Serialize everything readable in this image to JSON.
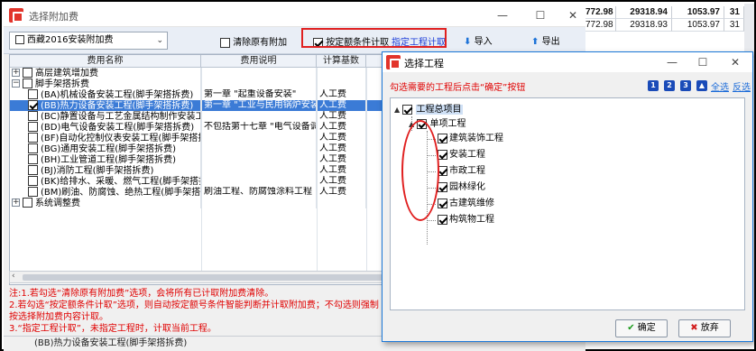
{
  "main_window": {
    "title": "选择附加费",
    "min": "—",
    "max": "☐",
    "close": "✕"
  },
  "toolbar": {
    "combo_value": "西藏2016安装附加费",
    "clear_label": "清除原有附加",
    "by_condition_label": "按定额条件计取",
    "specify_link": "指定工程计取",
    "import_label": "导入",
    "export_label": "导出"
  },
  "grid": {
    "columns": [
      "费用名称",
      "费用说明",
      "计算基数"
    ],
    "rows": [
      {
        "name": "高层建筑增加费",
        "desc": "",
        "base": "",
        "level": 0,
        "exp": "+",
        "chk": true
      },
      {
        "name": "脚手架搭拆费",
        "desc": "",
        "base": "",
        "level": 0,
        "exp": "−",
        "chk": true
      },
      {
        "name": "(BA)机械设备安装工程(脚手架搭拆费)",
        "desc": "第一章 \"起重设备安装\"",
        "base": "人工费",
        "level": 1,
        "chk": true,
        "checked": false
      },
      {
        "name": "(BB)热力设备安装工程(脚手架搭拆费)",
        "desc": "第一章 \"工业与民用锅炉安装",
        "base": "人工费",
        "level": 1,
        "chk": true,
        "checked": true,
        "selected": true
      },
      {
        "name": "(BC)静置设备与工艺金属结构制作安装工程",
        "desc": "",
        "base": "人工费",
        "level": 1,
        "chk": true,
        "checked": false
      },
      {
        "name": "(BD)电气设备安装工程(脚手架搭拆费)",
        "desc": "不包括第十七章 \"电气设备调",
        "base": "人工费",
        "level": 1,
        "chk": true,
        "checked": false
      },
      {
        "name": "(BF)自动化控制仪表安装工程(脚手架搭拆",
        "desc": "",
        "base": "人工费",
        "level": 1,
        "chk": true,
        "checked": false
      },
      {
        "name": "(BG)通用安装工程(脚手架搭拆费)",
        "desc": "",
        "base": "人工费",
        "level": 1,
        "chk": true,
        "checked": false
      },
      {
        "name": "(BH)工业管道工程(脚手架搭拆费)",
        "desc": "",
        "base": "人工费",
        "level": 1,
        "chk": true,
        "checked": false
      },
      {
        "name": "(BJ)消防工程(脚手架搭拆费)",
        "desc": "",
        "base": "人工费",
        "level": 1,
        "chk": true,
        "checked": false
      },
      {
        "name": "(BK)给排水、采暖、燃气工程(脚手架搭拆",
        "desc": "",
        "base": "人工费",
        "level": 1,
        "chk": true,
        "checked": false
      },
      {
        "name": "(BM)刷油、防腐蚀、绝热工程(脚手架搭拆",
        "desc": "刷油工程、防腐蚀涂料工程",
        "base": "人工费",
        "level": 1,
        "chk": true,
        "checked": false
      },
      {
        "name": "系统调整费",
        "desc": "",
        "base": "",
        "level": 0,
        "exp": "+",
        "chk": true
      }
    ]
  },
  "notes": [
    "注:1.若勾选“清除原有附加费”选项，会将所有已计取附加费清除。",
    "    2.若勾选“按定额条件计取”选项，则自动按定额号条件智能判断并计取附加费；不勾选则强制",
    "按选择附加费内容计取。",
    "    3.“指定工程计取”，未指定工程时，计取当前工程。"
  ],
  "status_text": "(BB)热力设备安装工程(脚手架搭拆费)",
  "sheet": {
    "rows": [
      [
        "772.98",
        "29318.94",
        "1053.97",
        "31"
      ],
      [
        "772.98",
        "29318.93",
        "1053.97",
        "31"
      ]
    ]
  },
  "dialog": {
    "title": "选择工程",
    "min": "—",
    "max": "☐",
    "close": "✕",
    "hint": "勾选需要的工程后点击“确定”按钮",
    "nums": [
      "1",
      "2",
      "3"
    ],
    "select_all": "全选",
    "invert": "反选",
    "tree": {
      "root": "工程总项目",
      "unit": "单项工程",
      "items": [
        "建筑装饰工程",
        "安装工程",
        "市政工程",
        "园林绿化",
        "古建筑维修",
        "构筑物工程"
      ]
    },
    "ok_label": "确定",
    "cancel_label": "放弃"
  },
  "colors": {
    "accent_red": "#e02020",
    "selection_blue": "#3b7bd6",
    "link_blue": "#1a3bd8",
    "dialog_border": "#1b78d8"
  }
}
